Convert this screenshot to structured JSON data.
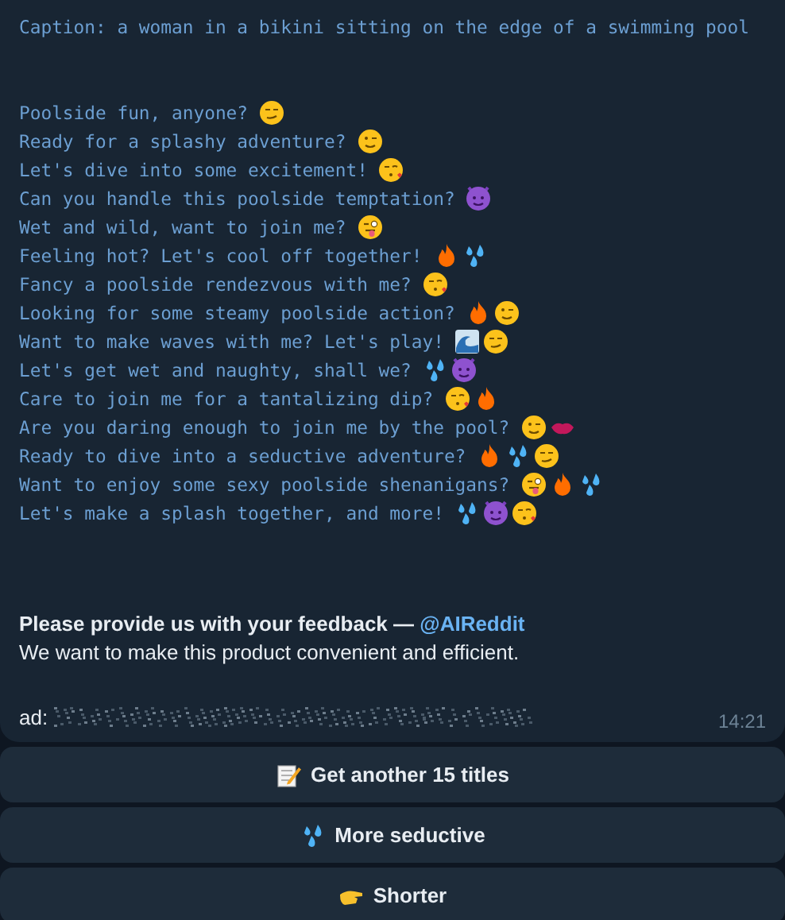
{
  "message": {
    "caption": "Caption: a woman in a bikini sitting on the edge of a swimming pool",
    "lines": [
      "Poolside fun, anyone?",
      "Ready for a splashy adventure?",
      "Let's dive into some excitement!",
      "Can you handle this poolside temptation?",
      "Wet and wild, want to join me?",
      "Feeling hot? Let's cool off together!",
      "Fancy a poolside rendezvous with me?",
      "Looking for some steamy poolside action?",
      "Want to make waves with me? Let's play!",
      "Let's get wet and naughty, shall we?",
      "Care to join me for a tantalizing dip?",
      "Are you daring enough to join me by the pool?",
      "Ready to dive into a seductive adventure?",
      "Want to enjoy some sexy poolside shenanigans?",
      "Let's make a splash together, and more!"
    ],
    "feedback": "Please provide us with your feedback — ",
    "feedback_link": "@AIReddit",
    "note": "We want to make this product convenient and efficient.",
    "ad_label": "ad:",
    "time": "14:21"
  },
  "buttons": [
    "Get another 15 titles",
    "More seductive",
    "Shorter"
  ]
}
